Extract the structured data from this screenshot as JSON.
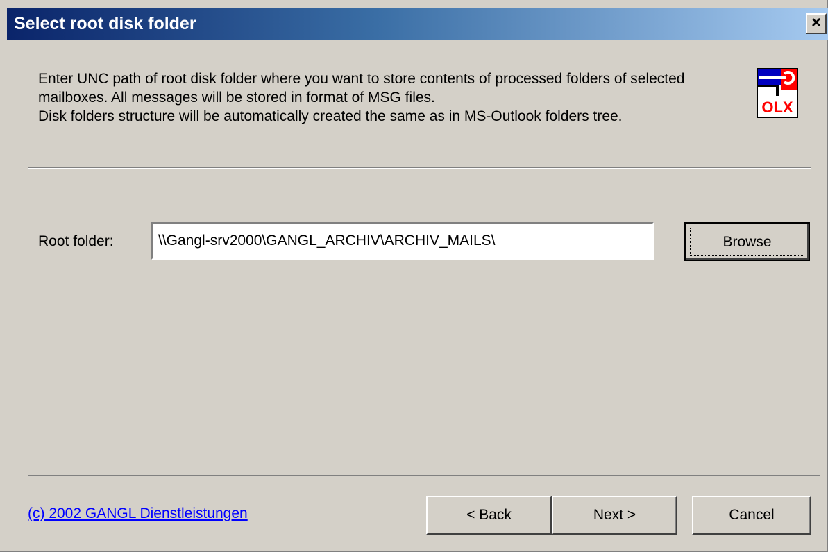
{
  "window": {
    "title": "Select root disk folder",
    "close_glyph": "×"
  },
  "description": {
    "line1": "Enter UNC path of root disk folder where you want to store contents of processed folders of selected mailboxes. All messages will be stored in format of MSG files.",
    "line2": "Disk folders structure will be automatically created the same as in MS-Outlook folders tree."
  },
  "logo": {
    "icon": "olx-tool-icon",
    "text": "OLX",
    "colors": {
      "red": "#ff0000",
      "blue": "#0000c0",
      "white": "#ffffff",
      "black": "#000000"
    }
  },
  "root_folder": {
    "label": "Root folder:",
    "value": "\\\\Gangl-srv2000\\GANGL_ARCHIV\\ARCHIV_MAILS\\"
  },
  "buttons": {
    "browse": "Browse",
    "back": "< Back",
    "next": "Next >",
    "cancel": "Cancel"
  },
  "footer": {
    "copyright_link": "(c) 2002 GANGL Dienstleistungen"
  },
  "colors": {
    "title_gradient_start": "#0a246a",
    "title_gradient_end": "#a6caf0",
    "dialog_bg": "#d4d0c8",
    "link": "#0000ff"
  }
}
